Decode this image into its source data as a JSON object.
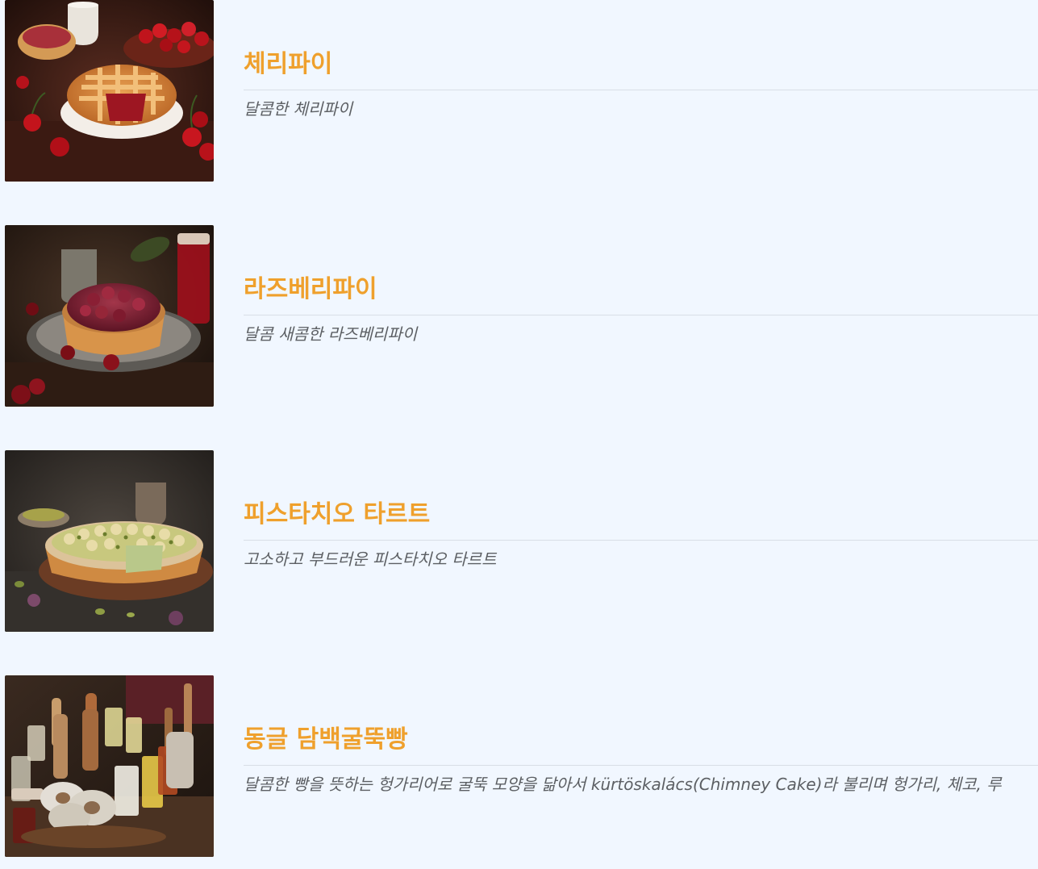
{
  "menu": {
    "items": [
      {
        "title": "체리파이",
        "description": "달콤한 체리파이",
        "image": "cherry-pie-photo"
      },
      {
        "title": "라즈베리파이",
        "description": "달콤 새콤한 라즈베리파이",
        "image": "raspberry-pie-photo"
      },
      {
        "title": "피스타치오 타르트",
        "description": "고소하고 부드러운 피스타치오 타르트",
        "image": "pistachio-tart-photo"
      },
      {
        "title": "동글 담백굴뚝빵",
        "description": "달콤한 빵을 뜻하는 헝가리어로 굴뚝 모양을 닮아서 kürtöskalács(Chimney Cake)라 불리며 헝가리, 체코, 루",
        "image": "chimney-cake-photo"
      }
    ]
  },
  "colors": {
    "background": "#f1f7ff",
    "title": "#efa02c",
    "description": "#5c5f63",
    "divider": "#d8dee6"
  }
}
